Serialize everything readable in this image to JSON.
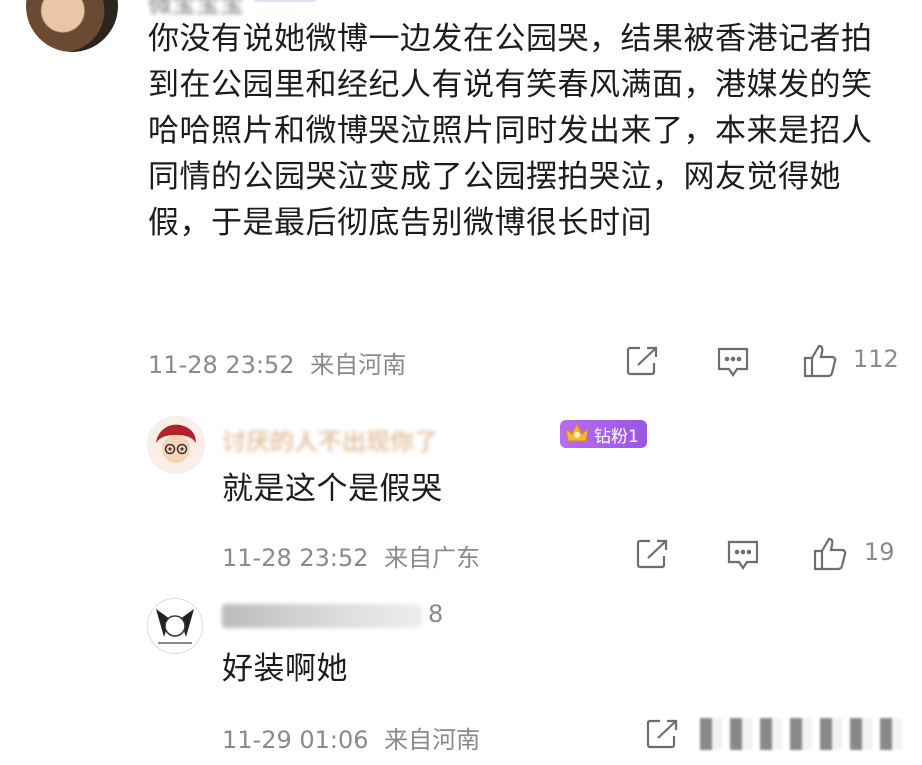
{
  "top_comment": {
    "username": "微宝宝宝",
    "text": "你没有说她微博一边发在公园哭，结果被香港记者拍到在公园里和经纪人有说有笑春风满面，港媒发的笑哈哈照片和微博哭泣照片同时发出来了，本来是招人同情的公园哭泣变成了公园摆拍哭泣，网友觉得她假，于是最后彻底告别微博很长时间",
    "timestamp": "11-28 23:52",
    "location": "来自河南",
    "like_count": "112"
  },
  "replies": [
    {
      "username": "讨厌的人不出现你了",
      "badge": "钻粉1",
      "text": "就是这个是假哭",
      "timestamp": "11-28 23:52",
      "location": "来自广东",
      "like_count": "19"
    },
    {
      "username": "用户188",
      "name_suffix": "8",
      "text": "好装啊她",
      "timestamp": "11-29 01:06",
      "location": "来自河南"
    }
  ],
  "icons": {
    "share": "share-icon",
    "comment": "comment-icon",
    "like": "like-icon"
  }
}
